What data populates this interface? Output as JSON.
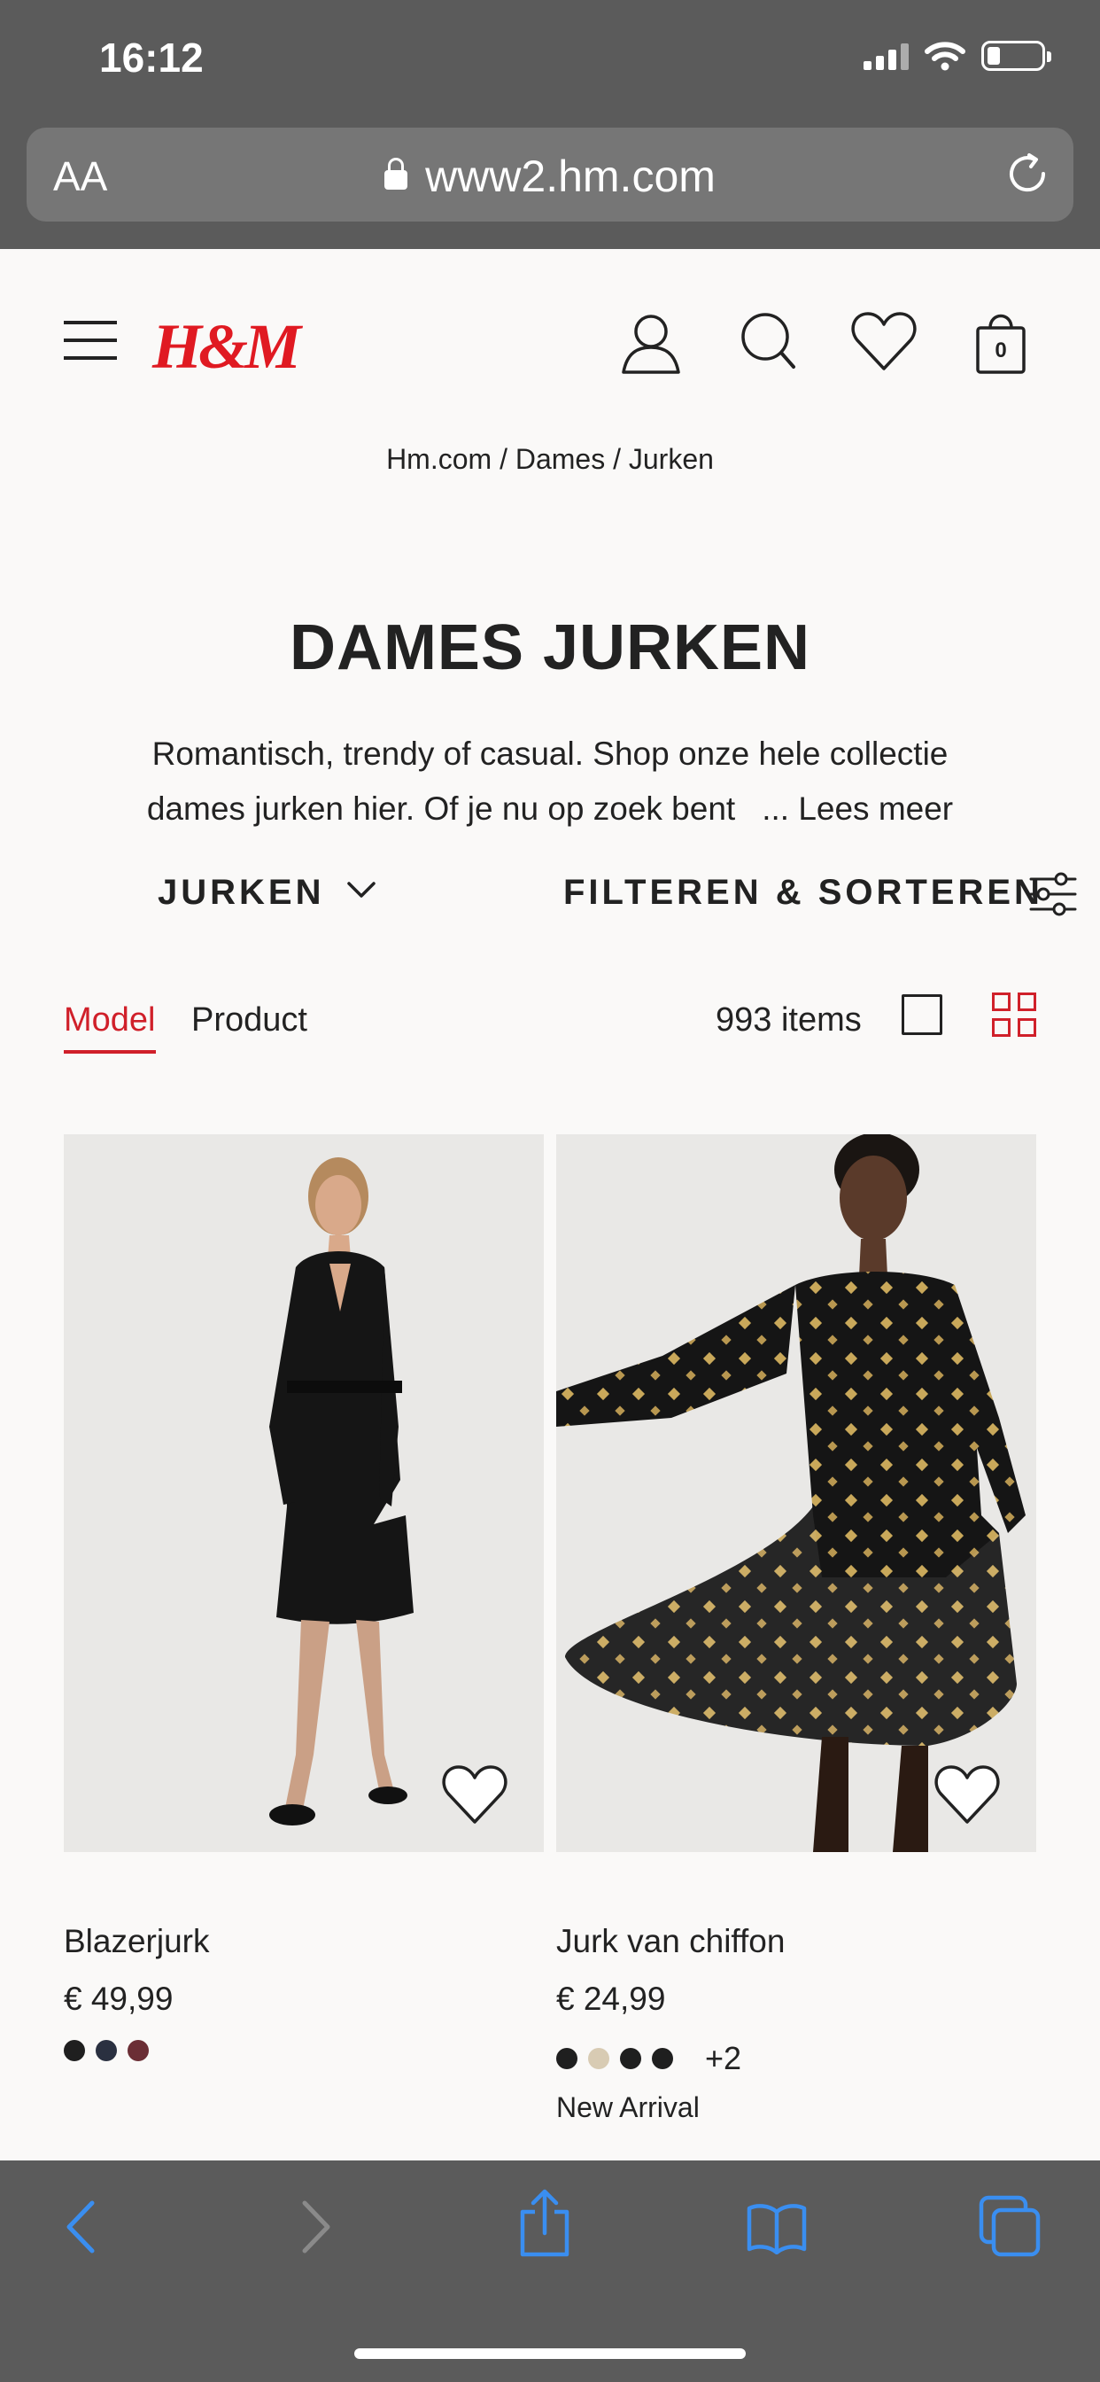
{
  "status_bar": {
    "time": "16:12"
  },
  "browser": {
    "text_size_label": "AA",
    "url": "www2.hm.com"
  },
  "header": {
    "logo": "H&M",
    "cart_count": "0"
  },
  "breadcrumb": "Hm.com / Dames / Jurken",
  "page": {
    "title": "DAMES JURKEN",
    "intro_line1": "Romantisch, trendy of casual. Shop onze hele collectie",
    "intro_line2": "dames jurken hier. Of je nu op zoek bent",
    "read_more": "... Lees meer"
  },
  "filters": {
    "category": "JURKEN",
    "filter_sort": "FILTEREN & SORTEREN"
  },
  "view": {
    "tab_model": "Model",
    "tab_product": "Product",
    "item_count": "993 items"
  },
  "products": [
    {
      "name": "Blazerjurk",
      "price": "€ 49,99",
      "swatches": [
        "#1f1f1f",
        "#2a3040",
        "#6b2e35"
      ],
      "extra_colors": "",
      "badge": ""
    },
    {
      "name": "Jurk van chiffon",
      "price": "€ 24,99",
      "swatches": [
        "#1f1f1f",
        "#d8cbb3",
        "#1f1f1f",
        "#1f1f1f"
      ],
      "extra_colors": "+2",
      "badge": "New Arrival"
    }
  ],
  "colors": {
    "brand_red": "#e01a22",
    "accent_red": "#d0202a",
    "toolbar_blue": "#3a8ef0"
  }
}
